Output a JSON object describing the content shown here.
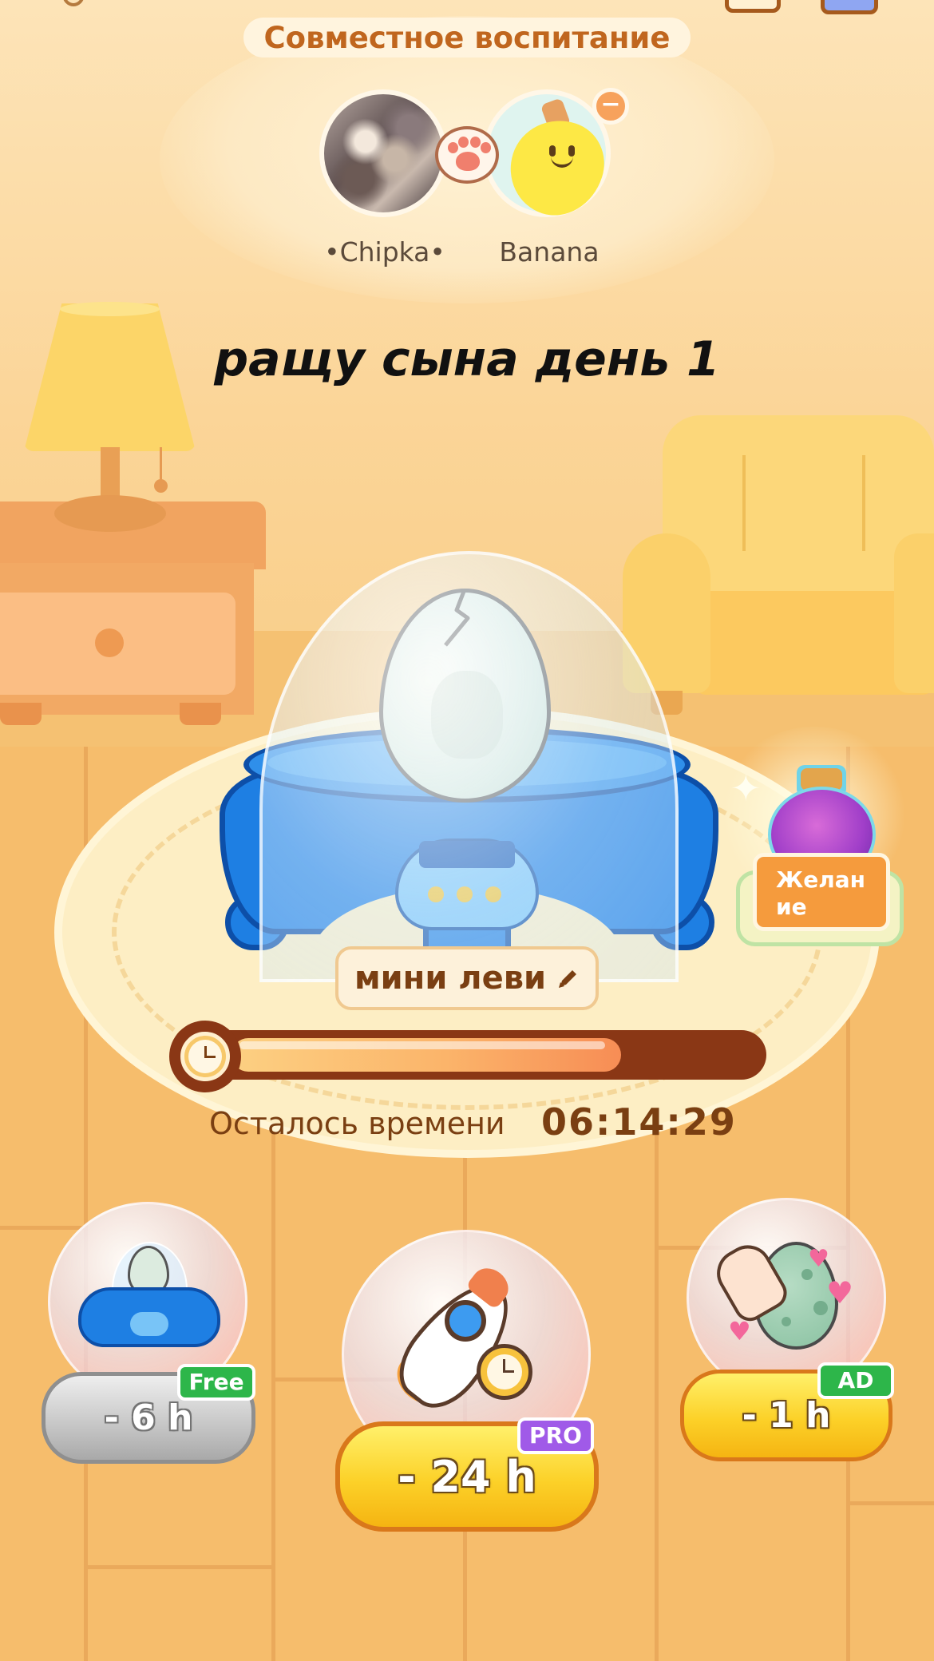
{
  "header": {
    "title": "Совместное воспитание"
  },
  "parents": [
    {
      "name": "•Chipka•"
    },
    {
      "name": "Banana"
    }
  ],
  "group": {
    "title": "ращу сына день 1"
  },
  "pet": {
    "name": "мини леви",
    "stage": "egg"
  },
  "wish": {
    "label": "Желание"
  },
  "timer": {
    "label": "Осталось времени",
    "value": "06:14:29",
    "progress": 0.74
  },
  "boosters": [
    {
      "label": "- 6 h",
      "tag": "Free"
    },
    {
      "label": "- 24 h",
      "tag": "PRO"
    },
    {
      "label": "- 1 h",
      "tag": "AD"
    }
  ],
  "icons": {
    "remove": "minus-icon",
    "paw": "paw-icon",
    "edit": "pencil-icon",
    "clock": "clock-icon"
  },
  "colors": {
    "title": "#c0661e",
    "text_brown": "#7a3f12",
    "incubator_blue": "#1e7fe3",
    "progress_track": "#8a3715",
    "free_tag": "#2db64a",
    "pro_tag": "#a05ae8",
    "button_yellow": "#fcd128"
  }
}
